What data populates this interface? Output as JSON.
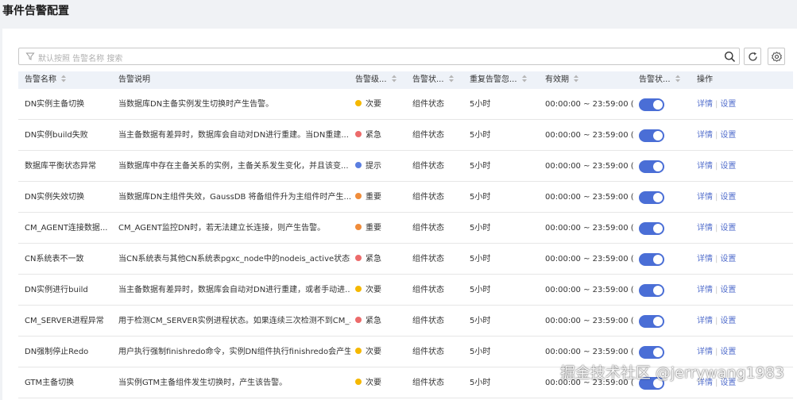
{
  "page": {
    "title": "事件告警配置"
  },
  "toolbar": {
    "search_placeholder": "默认按照 告警名称 搜索"
  },
  "colors": {
    "accent": "#4a6ed6",
    "link": "#526ecc",
    "level_secondary": "#f5b800",
    "level_urgent": "#ec6b6b",
    "level_hint": "#5a7ee0",
    "level_important": "#f08c3a"
  },
  "table": {
    "headers": {
      "name": "告警名称",
      "desc": "告警说明",
      "level": "告警级...",
      "type": "告警状...",
      "repeat": "重复告警忽...",
      "valid": "有效期",
      "switch": "告警状...",
      "ops": "操作"
    },
    "ops": {
      "detail": "详情",
      "sep": "|",
      "settings": "设置"
    },
    "rows": [
      {
        "name": "DN实例主备切换",
        "desc": "当数据库DN主备实例发生切换时产生告警。",
        "level": "次要",
        "level_color": "#f5b800",
        "type": "组件状态",
        "repeat": "5小时",
        "valid": "00:00:00 ~ 23:59:00 (...",
        "enabled": true
      },
      {
        "name": "DN实例build失败",
        "desc": "当主备数据有差异时，数据库会自动对DN进行重建。当DN重建...",
        "level": "紧急",
        "level_color": "#ec6b6b",
        "type": "组件状态",
        "repeat": "5小时",
        "valid": "00:00:00 ~ 23:59:00 (...",
        "enabled": true
      },
      {
        "name": "数据库平衡状态异常",
        "desc": "当数据库中存在主备关系的实例，主备关系发生变化，并且该变...",
        "level": "提示",
        "level_color": "#5a7ee0",
        "type": "组件状态",
        "repeat": "5小时",
        "valid": "00:00:00 ~ 23:59:00 (...",
        "enabled": true
      },
      {
        "name": "DN实例失效切换",
        "desc": "当数据库DN主组件失效，GaussDB 将备组件升为主组件时产生...",
        "level": "重要",
        "level_color": "#f08c3a",
        "type": "组件状态",
        "repeat": "5小时",
        "valid": "00:00:00 ~ 23:59:00 (...",
        "enabled": true
      },
      {
        "name": "CM_AGENT连接数据...",
        "desc": "CM_AGENT监控DN时，若无法建立长连接，则产生告警。",
        "level": "重要",
        "level_color": "#f08c3a",
        "type": "组件状态",
        "repeat": "5小时",
        "valid": "00:00:00 ~ 23:59:00 (...",
        "enabled": true
      },
      {
        "name": "CN系统表不一致",
        "desc": "当CN系统表与其他CN系统表pgxc_node中的nodeis_active状态不...",
        "level": "紧急",
        "level_color": "#ec6b6b",
        "type": "组件状态",
        "repeat": "5小时",
        "valid": "00:00:00 ~ 23:59:00 (...",
        "enabled": true
      },
      {
        "name": "DN实例进行build",
        "desc": "当主备数据有差异时，数据库会自动对DN进行重建，或者手动进...",
        "level": "次要",
        "level_color": "#f5b800",
        "type": "组件状态",
        "repeat": "5小时",
        "valid": "00:00:00 ~ 23:59:00 (...",
        "enabled": true
      },
      {
        "name": "CM_SERVER进程异常",
        "desc": "用于检测CM_SERVER实例进程状态。如果连续三次检测不到CM_...",
        "level": "紧急",
        "level_color": "#ec6b6b",
        "type": "组件状态",
        "repeat": "5小时",
        "valid": "00:00:00 ~ 23:59:00 (...",
        "enabled": true
      },
      {
        "name": "DN强制停止Redo",
        "desc": "用户执行强制finishredo命令，实例DN组件执行finishredo会产生...",
        "level": "次要",
        "level_color": "#f5b800",
        "type": "组件状态",
        "repeat": "5小时",
        "valid": "00:00:00 ~ 23:59:00 (...",
        "enabled": true
      },
      {
        "name": "GTM主备切换",
        "desc": "当实例GTM主备组件发生切换时，产生该告警。",
        "level": "次要",
        "level_color": "#f5b800",
        "type": "组件状态",
        "repeat": "5小时",
        "valid": "00:00:00 ~ 23:59:00 (...",
        "enabled": true
      }
    ]
  },
  "watermark": {
    "text": "掘金技术社区 @jerrywang1983"
  }
}
